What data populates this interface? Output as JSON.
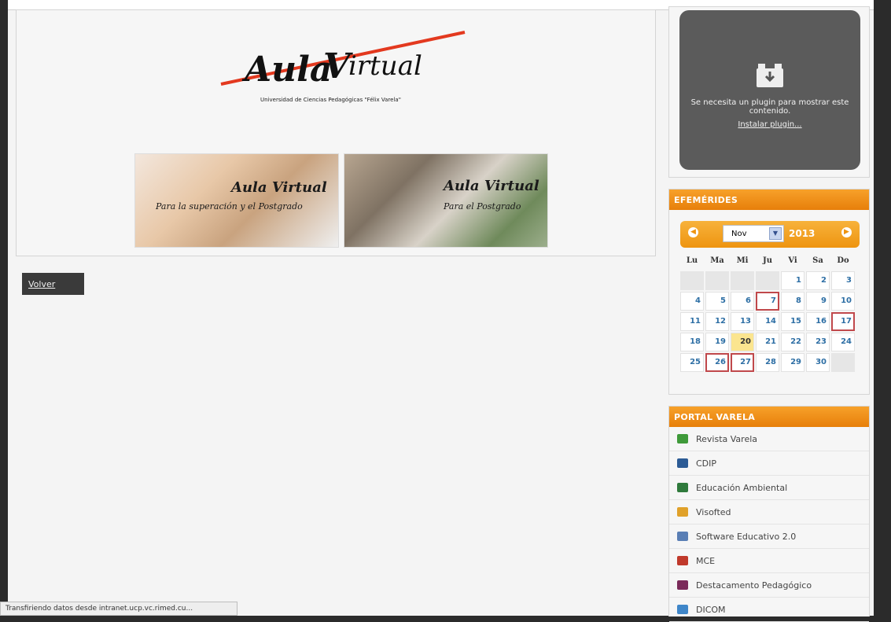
{
  "header": {
    "logo_text": "Aula Virtual",
    "logo_subtitle": "Universidad de Ciencias Pedagógicas \"Félix Varela\"",
    "banner": [
      {
        "title": "Aula Virtual",
        "subtitle": "Para la superación y el Postgrado"
      },
      {
        "title": "Aula Virtual",
        "subtitle": "Para el Postgrado"
      }
    ]
  },
  "main": {
    "back_label": "Volver"
  },
  "plugin": {
    "message": "Se necesita un plugin para mostrar este contenido.",
    "install_link": "Instalar plugin..."
  },
  "calendar": {
    "title": "EFEMÉRIDES",
    "month": "Nov",
    "year": "2013",
    "weekdays": [
      "Lu",
      "Ma",
      "Mi",
      "Ju",
      "Vi",
      "Sa",
      "Do"
    ],
    "today": "20",
    "event_days": [
      "7",
      "17",
      "26",
      "27"
    ],
    "weeks": [
      [
        "",
        "",
        "",
        "",
        "1",
        "2",
        "3"
      ],
      [
        "4",
        "5",
        "6",
        "7",
        "8",
        "9",
        "10"
      ],
      [
        "11",
        "12",
        "13",
        "14",
        "15",
        "16",
        "17"
      ],
      [
        "18",
        "19",
        "20",
        "21",
        "22",
        "23",
        "24"
      ],
      [
        "25",
        "26",
        "27",
        "28",
        "29",
        "30",
        ""
      ]
    ]
  },
  "portal": {
    "title": "PORTAL VARELA",
    "items": [
      {
        "label": "Revista Varela",
        "icon": "revista-icon",
        "color": "#3f9a3a"
      },
      {
        "label": "CDIP",
        "icon": "cdip-icon",
        "color": "#2c5b95"
      },
      {
        "label": "Educación Ambiental",
        "icon": "ambiental-icon",
        "color": "#2f7a3c"
      },
      {
        "label": "Visofted",
        "icon": "visofted-icon",
        "color": "#e0a12a"
      },
      {
        "label": "Software Educativo 2.0",
        "icon": "software-icon",
        "color": "#5a7fb5"
      },
      {
        "label": "MCE",
        "icon": "mce-icon",
        "color": "#c0392b"
      },
      {
        "label": "Destacamento Pedagógico",
        "icon": "destacamento-icon",
        "color": "#7b2b5a"
      },
      {
        "label": "DICOM",
        "icon": "dicom-icon",
        "color": "#3f86c9"
      }
    ]
  },
  "status_bar": "Transfiriendo datos desde intranet.ucp.vc.rimed.cu..."
}
